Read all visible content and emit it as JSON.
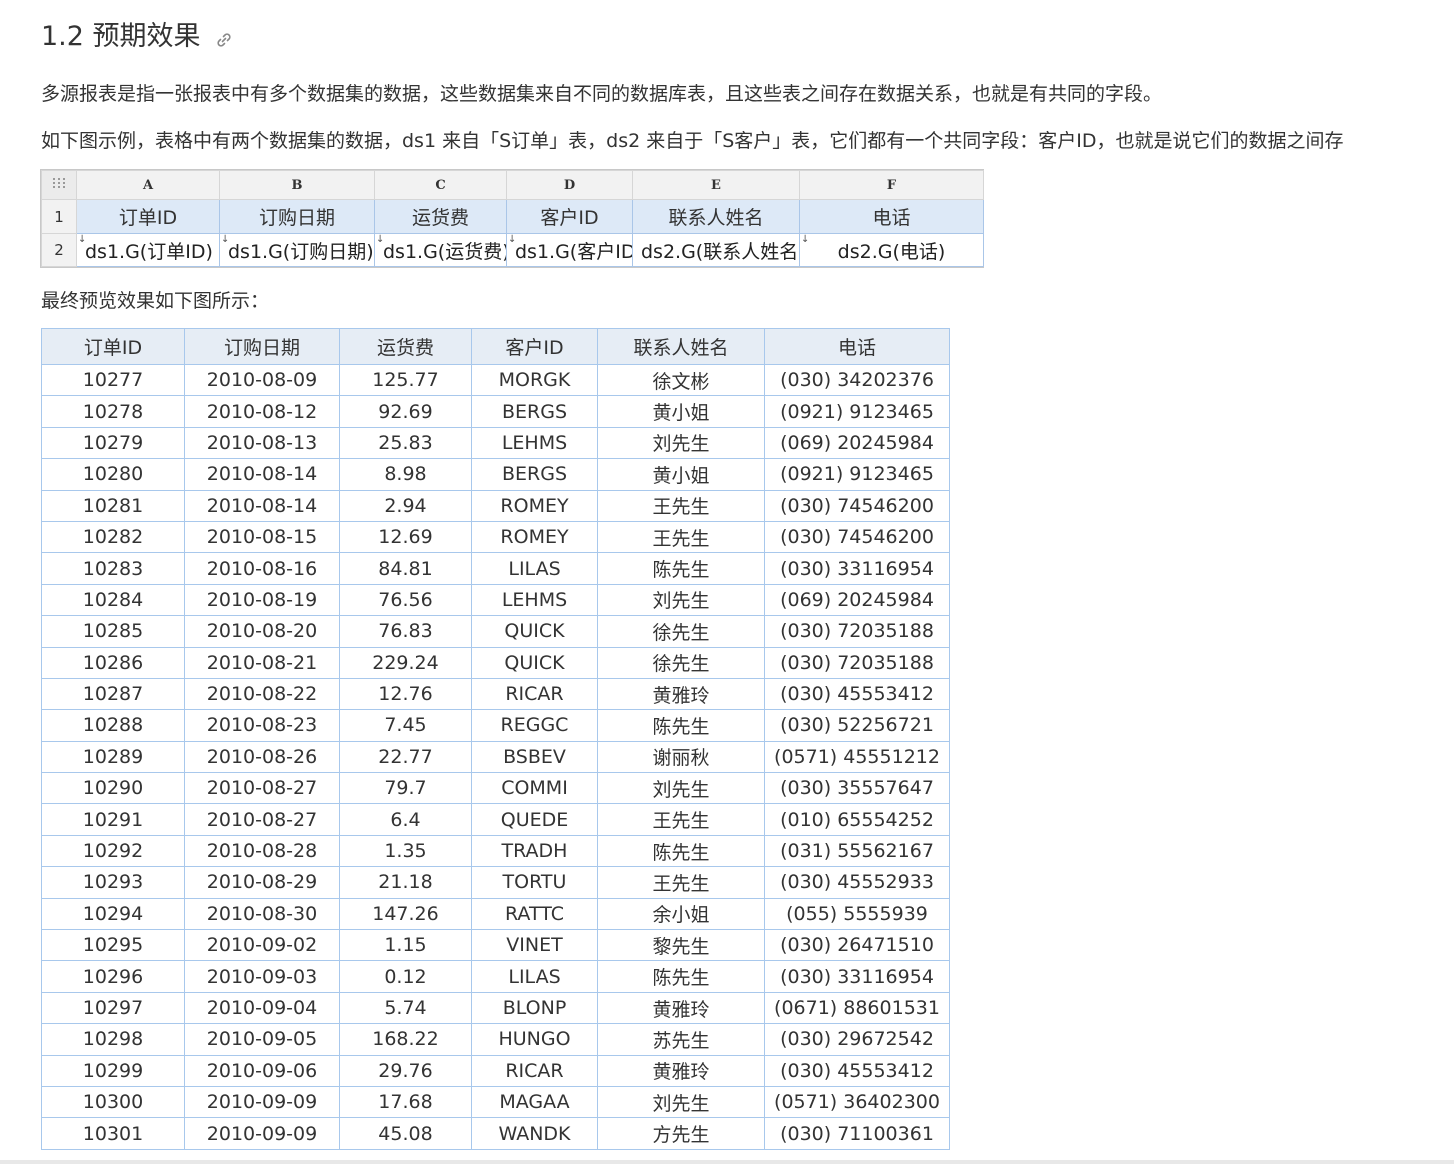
{
  "section": {
    "title": "1.2 预期效果",
    "anchor_icon": "link-icon"
  },
  "paragraphs": {
    "intro": "多源报表是指一张报表中有多个数据集的数据，这些数据集来自不同的数据库表，且这些表之间存在数据关系，也就是有共同的字段。",
    "example": "如下图示例，表格中有两个数据集的数据，ds1 来自「S订单」表，ds2 来自于「S客户」表，它们都有一个共同字段：客户ID，也就是说它们的数据之间存",
    "preview": "最终预览效果如下图所示："
  },
  "designer": {
    "corner_icon": "grid-handle-icon",
    "columns": [
      "A",
      "B",
      "C",
      "D",
      "E",
      "F"
    ],
    "rows": [
      {
        "num": "1",
        "cells": [
          "订单ID",
          "订购日期",
          "运货费",
          "客户ID",
          "联系人姓名",
          "电话"
        ]
      },
      {
        "num": "2",
        "cells": [
          "ds1.G(订单ID)",
          "ds1.G(订购日期)",
          "ds1.G(运货费)",
          "ds1.G(客户ID",
          "ds2.G(联系人姓名)",
          "ds2.G(电话)"
        ]
      }
    ],
    "expand_mark": "↓"
  },
  "result_table": {
    "headers": [
      "订单ID",
      "订购日期",
      "运货费",
      "客户ID",
      "联系人姓名",
      "电话"
    ],
    "rows": [
      [
        "10277",
        "2010-08-09",
        "125.77",
        "MORGK",
        "徐文彬",
        "(030) 34202376"
      ],
      [
        "10278",
        "2010-08-12",
        "92.69",
        "BERGS",
        "黄小姐",
        "(0921) 9123465"
      ],
      [
        "10279",
        "2010-08-13",
        "25.83",
        "LEHMS",
        "刘先生",
        "(069) 20245984"
      ],
      [
        "10280",
        "2010-08-14",
        "8.98",
        "BERGS",
        "黄小姐",
        "(0921) 9123465"
      ],
      [
        "10281",
        "2010-08-14",
        "2.94",
        "ROMEY",
        "王先生",
        "(030) 74546200"
      ],
      [
        "10282",
        "2010-08-15",
        "12.69",
        "ROMEY",
        "王先生",
        "(030) 74546200"
      ],
      [
        "10283",
        "2010-08-16",
        "84.81",
        "LILAS",
        "陈先生",
        "(030) 33116954"
      ],
      [
        "10284",
        "2010-08-19",
        "76.56",
        "LEHMS",
        "刘先生",
        "(069) 20245984"
      ],
      [
        "10285",
        "2010-08-20",
        "76.83",
        "QUICK",
        "徐先生",
        "(030) 72035188"
      ],
      [
        "10286",
        "2010-08-21",
        "229.24",
        "QUICK",
        "徐先生",
        "(030) 72035188"
      ],
      [
        "10287",
        "2010-08-22",
        "12.76",
        "RICAR",
        "黄雅玲",
        "(030) 45553412"
      ],
      [
        "10288",
        "2010-08-23",
        "7.45",
        "REGGC",
        "陈先生",
        "(030) 52256721"
      ],
      [
        "10289",
        "2010-08-26",
        "22.77",
        "BSBEV",
        "谢丽秋",
        "(0571) 45551212"
      ],
      [
        "10290",
        "2010-08-27",
        "79.7",
        "COMMI",
        "刘先生",
        "(030) 35557647"
      ],
      [
        "10291",
        "2010-08-27",
        "6.4",
        "QUEDE",
        "王先生",
        "(010) 65554252"
      ],
      [
        "10292",
        "2010-08-28",
        "1.35",
        "TRADH",
        "陈先生",
        "(031) 55562167"
      ],
      [
        "10293",
        "2010-08-29",
        "21.18",
        "TORTU",
        "王先生",
        "(030) 45552933"
      ],
      [
        "10294",
        "2010-08-30",
        "147.26",
        "RATTC",
        "余小姐",
        "(055) 5555939"
      ],
      [
        "10295",
        "2010-09-02",
        "1.15",
        "VINET",
        "黎先生",
        "(030) 26471510"
      ],
      [
        "10296",
        "2010-09-03",
        "0.12",
        "LILAS",
        "陈先生",
        "(030) 33116954"
      ],
      [
        "10297",
        "2010-09-04",
        "5.74",
        "BLONP",
        "黄雅玲",
        "(0671) 88601531"
      ],
      [
        "10298",
        "2010-09-05",
        "168.22",
        "HUNGO",
        "苏先生",
        "(030) 29672542"
      ],
      [
        "10299",
        "2010-09-06",
        "29.76",
        "RICAR",
        "黄雅玲",
        "(030) 45553412"
      ],
      [
        "10300",
        "2010-09-09",
        "17.68",
        "MAGAA",
        "刘先生",
        "(0571) 36402300"
      ],
      [
        "10301",
        "2010-09-09",
        "45.08",
        "WANDK",
        "方先生",
        "(030) 71100361"
      ]
    ]
  }
}
